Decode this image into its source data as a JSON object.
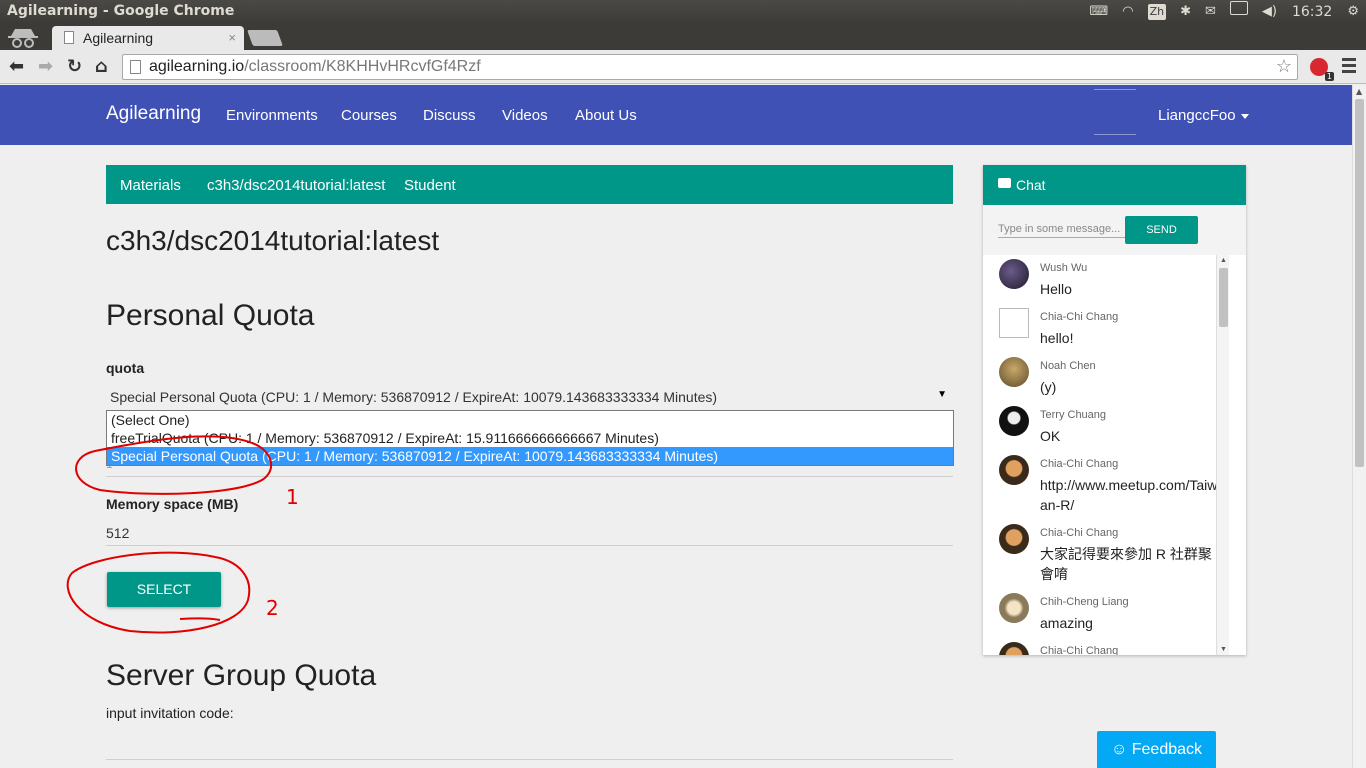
{
  "os": {
    "window_title": "Agilearning - Google Chrome",
    "ime": "Zh",
    "clock": "16:32"
  },
  "browser": {
    "tab_title": "Agilearning",
    "tab_close": "×",
    "url_host": "agilearning.io",
    "url_path": "/classroom/K8KHHvHRcvfGf4Rzf",
    "extension_badge": "1"
  },
  "navbar": {
    "brand": "Agilearning",
    "items": [
      "Environments",
      "Courses",
      "Discuss",
      "Videos",
      "About Us"
    ],
    "user": "LiangccFoo"
  },
  "breadcrumbs": [
    "Materials",
    "c3h3/dsc2014tutorial:latest",
    "Student"
  ],
  "page": {
    "image_title": "c3h3/dsc2014tutorial:latest",
    "personal_quota_heading": "Personal Quota",
    "quota_label": "quota",
    "quota_selected": "Special Personal Quota (CPU: 1 / Memory: 536870912 / ExpireAt: 10079.143683333334 Minutes)",
    "quota_options": [
      "(Select One)",
      "freeTrialQuota (CPU: 1 / Memory: 536870912 / ExpireAt: 15.911666666666667 Minutes)",
      "Special Personal Quota (CPU: 1 / Memory: 536870912 / ExpireAt: 10079.143683333334 Minutes)"
    ],
    "cpu_value": "1",
    "memory_label": "Memory space (MB)",
    "memory_value": "512",
    "select_button": "SELECT",
    "server_group_heading": "Server Group Quota",
    "invitation_label": "input invitation code:"
  },
  "annotations": {
    "mark_1": "1",
    "mark_2": "2",
    "color": "#e00000"
  },
  "chat": {
    "header": "Chat",
    "input_placeholder": "Type in some message...",
    "send_button": "SEND",
    "messages": [
      {
        "name": "Wush Wu",
        "text": "Hello"
      },
      {
        "name": "Chia-Chi Chang",
        "text": "hello!"
      },
      {
        "name": "Noah Chen",
        "text": "(y)"
      },
      {
        "name": "Terry Chuang",
        "text": "OK"
      },
      {
        "name": "Chia-Chi Chang",
        "text": "http://www.meetup.com/Taiwan-R/"
      },
      {
        "name": "Chia-Chi Chang",
        "text": "大家記得要來參加 R 社群聚會唷"
      },
      {
        "name": "Chih-Cheng Liang",
        "text": "amazing"
      },
      {
        "name": "Chia-Chi Chang",
        "text": ""
      }
    ]
  },
  "feedback_button": "☺ Feedback",
  "colors": {
    "navbar": "#3f51b5",
    "teal": "#009688",
    "feedback": "#03a9f4",
    "option_highlight": "#3399ff"
  }
}
